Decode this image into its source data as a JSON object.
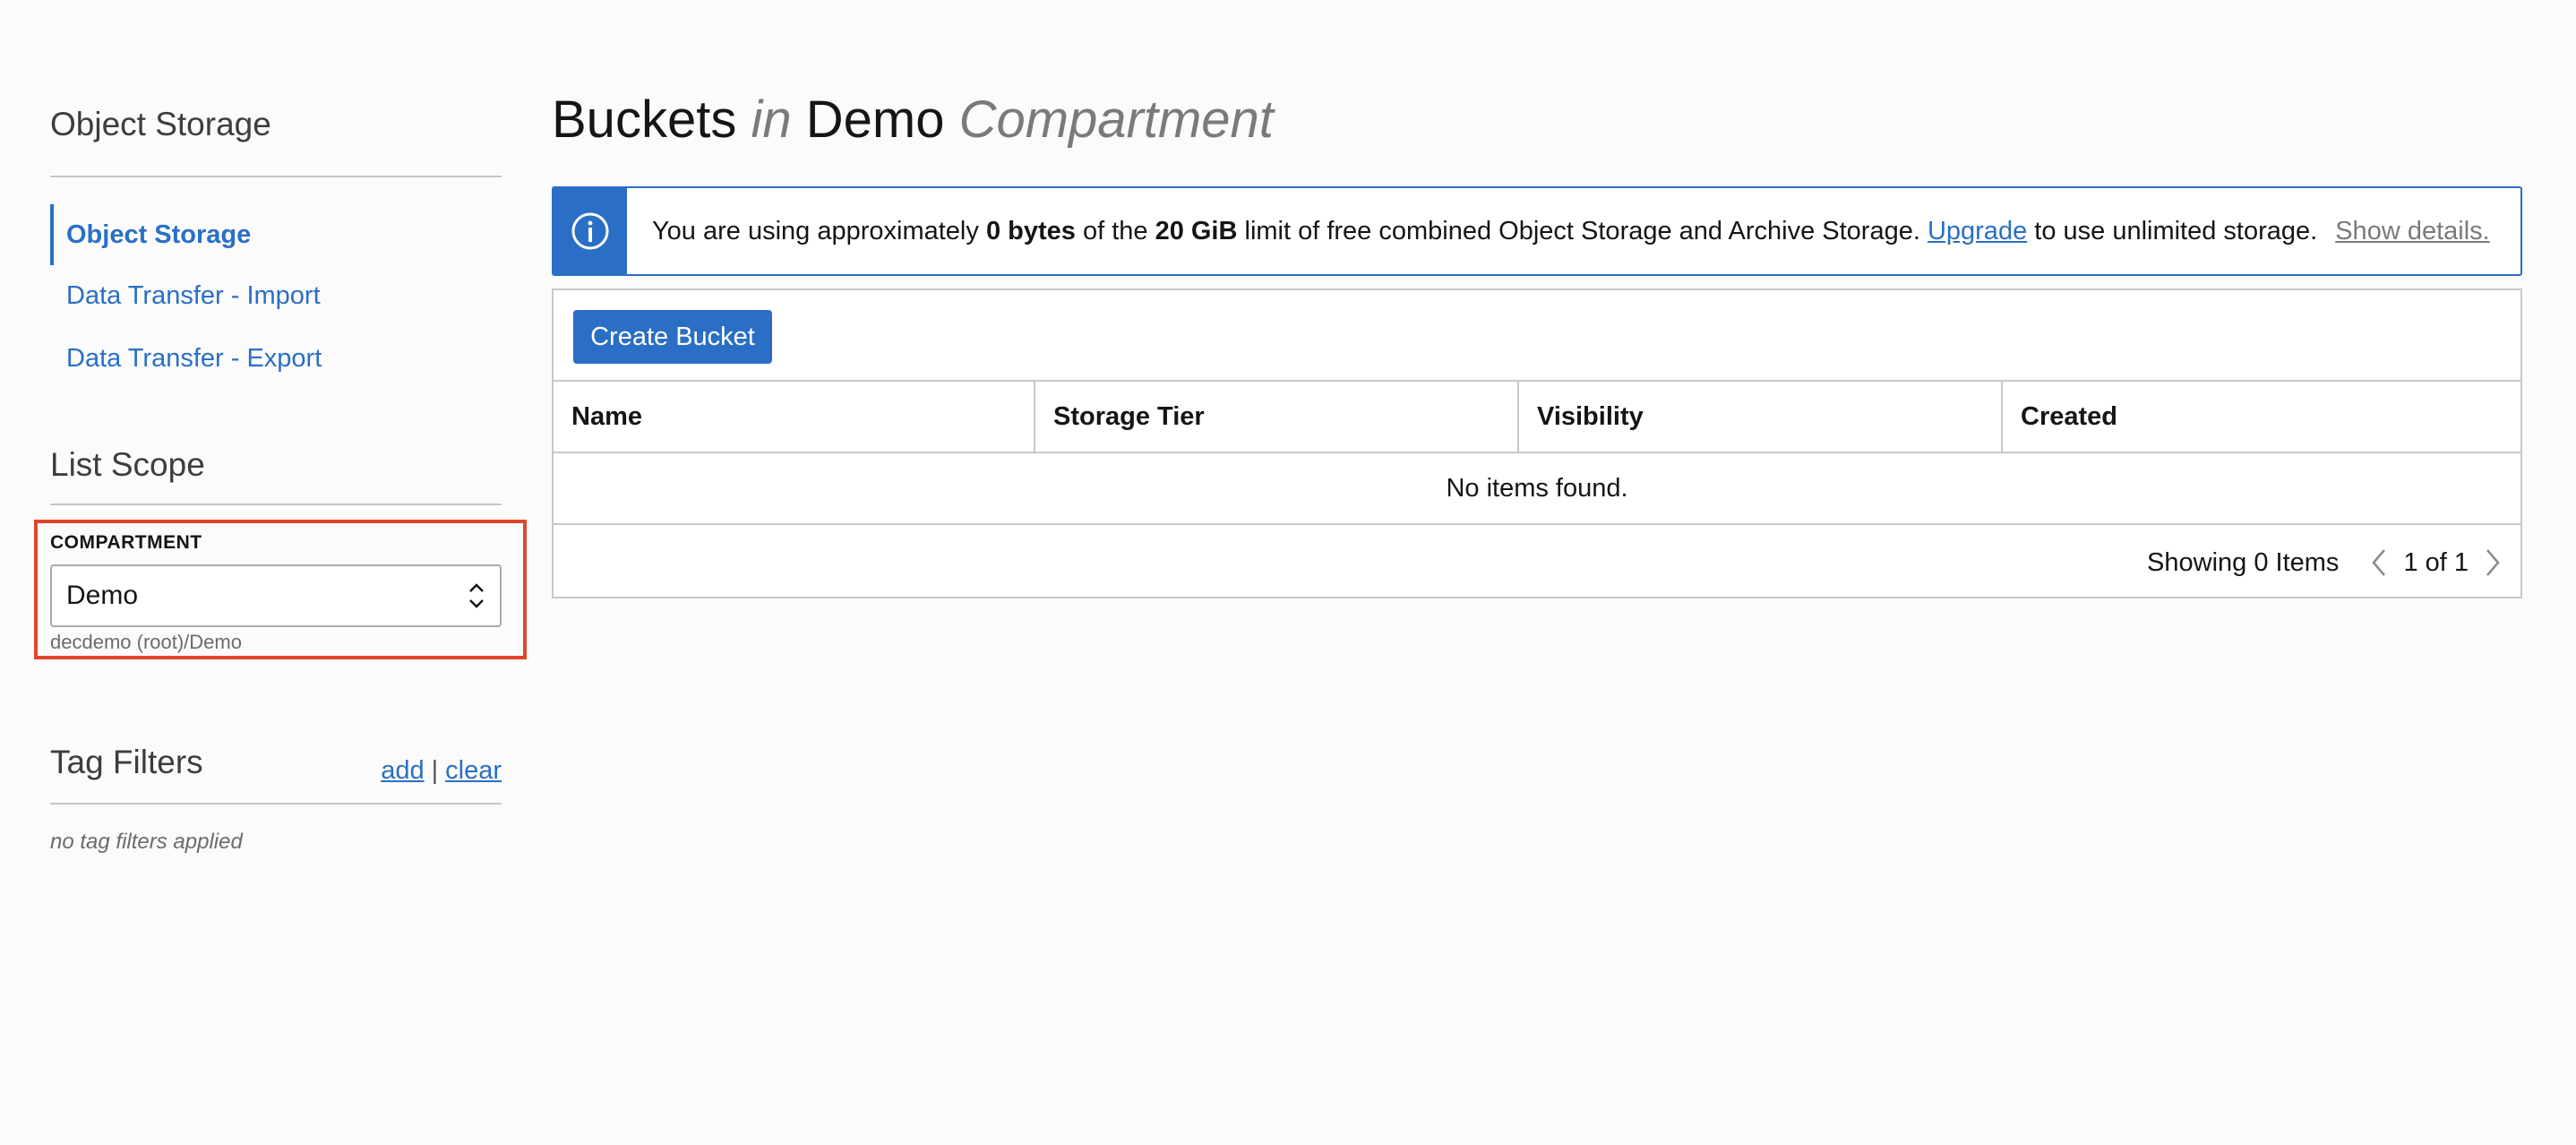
{
  "sidebar": {
    "section_title": "Object Storage",
    "nav_items": [
      {
        "label": "Object Storage",
        "active": true
      },
      {
        "label": "Data Transfer - Import",
        "active": false
      },
      {
        "label": "Data Transfer - Export",
        "active": false
      }
    ],
    "list_scope_title": "List Scope",
    "compartment": {
      "label": "COMPARTMENT",
      "selected": "Demo",
      "path": "decdemo (root)/Demo"
    },
    "tag_filters": {
      "title": "Tag Filters",
      "add_label": "add",
      "separator": "|",
      "clear_label": "clear",
      "empty_text": "no tag filters applied"
    }
  },
  "main": {
    "title": {
      "part1": "Buckets",
      "part2": "in",
      "part3": "Demo",
      "part4": "Compartment"
    },
    "banner": {
      "icon": "info-icon",
      "text_1": "You are using approximately ",
      "bold_1": "0 bytes",
      "text_2": " of the ",
      "bold_2": "20 GiB",
      "text_3": " limit of free combined Object Storage and Archive Storage. ",
      "link": "Upgrade",
      "text_4": " to use unlimited storage.",
      "details": "Show details."
    },
    "create_button": "Create Bucket",
    "columns": [
      "Name",
      "Storage Tier",
      "Visibility",
      "Created"
    ],
    "empty_message": "No items found.",
    "pager": {
      "count": "Showing 0 Items",
      "page": "1 of 1"
    }
  },
  "colors": {
    "accent": "#2a6fc5",
    "highlight_border": "#e0452c",
    "background": "#fbfbfb"
  }
}
